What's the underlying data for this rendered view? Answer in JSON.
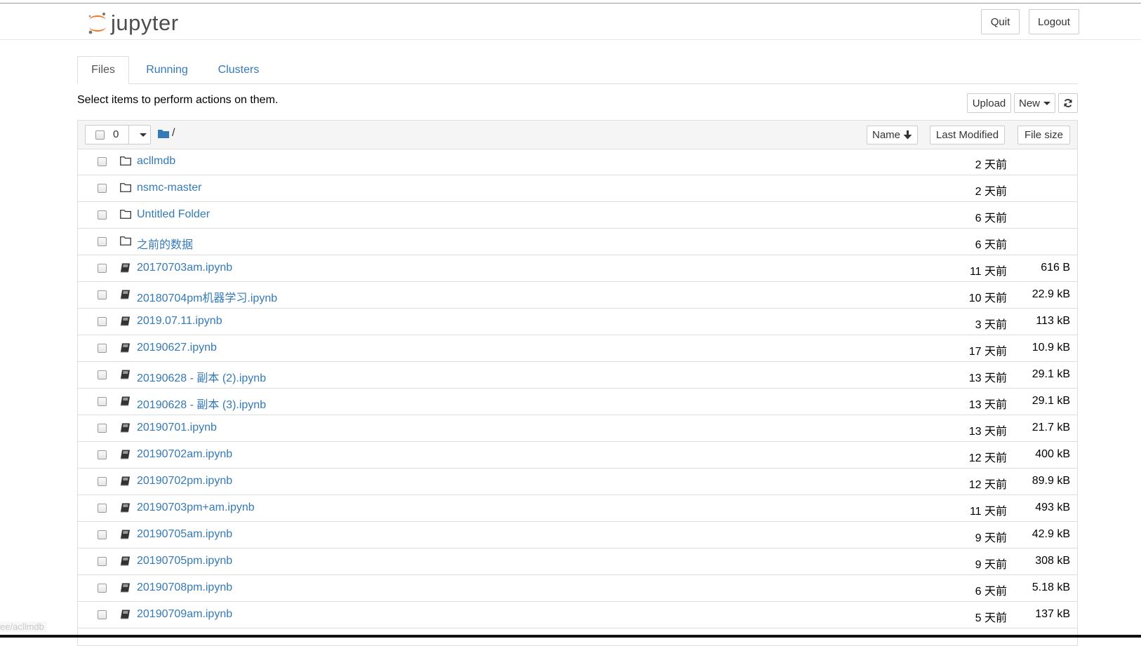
{
  "header": {
    "logo_text": "jupyter",
    "quit_label": "Quit",
    "logout_label": "Logout"
  },
  "tabs": [
    {
      "label": "Files",
      "active": true
    },
    {
      "label": "Running",
      "active": false
    },
    {
      "label": "Clusters",
      "active": false
    }
  ],
  "toolbar": {
    "instructions": "Select items to perform actions on them.",
    "upload_label": "Upload",
    "new_label": "New"
  },
  "list_header": {
    "selected_count": "0",
    "breadcrumb": "/",
    "sort_name_label": "Name",
    "sort_modified_label": "Last Modified",
    "sort_size_label": "File size"
  },
  "files": [
    {
      "type": "folder",
      "name": "acllmdb",
      "modified": "2 天前",
      "size": ""
    },
    {
      "type": "folder",
      "name": "nsmc-master",
      "modified": "2 天前",
      "size": ""
    },
    {
      "type": "folder",
      "name": "Untitled Folder",
      "modified": "6 天前",
      "size": ""
    },
    {
      "type": "folder",
      "name": "之前的数据",
      "modified": "6 天前",
      "size": ""
    },
    {
      "type": "notebook",
      "name": "20170703am.ipynb",
      "modified": "11 天前",
      "size": "616 B"
    },
    {
      "type": "notebook",
      "name": "20180704pm机器学习.ipynb",
      "modified": "10 天前",
      "size": "22.9 kB"
    },
    {
      "type": "notebook",
      "name": "2019.07.11.ipynb",
      "modified": "3 天前",
      "size": "113 kB"
    },
    {
      "type": "notebook",
      "name": "20190627.ipynb",
      "modified": "17 天前",
      "size": "10.9 kB"
    },
    {
      "type": "notebook",
      "name": "20190628 - 副本 (2).ipynb",
      "modified": "13 天前",
      "size": "29.1 kB"
    },
    {
      "type": "notebook",
      "name": "20190628 - 副本 (3).ipynb",
      "modified": "13 天前",
      "size": "29.1 kB"
    },
    {
      "type": "notebook",
      "name": "20190701.ipynb",
      "modified": "13 天前",
      "size": "21.7 kB"
    },
    {
      "type": "notebook",
      "name": "20190702am.ipynb",
      "modified": "12 天前",
      "size": "400 kB"
    },
    {
      "type": "notebook",
      "name": "20190702pm.ipynb",
      "modified": "12 天前",
      "size": "89.9 kB"
    },
    {
      "type": "notebook",
      "name": "20190703pm+am.ipynb",
      "modified": "11 天前",
      "size": "493 kB"
    },
    {
      "type": "notebook",
      "name": "20190705am.ipynb",
      "modified": "9 天前",
      "size": "42.9 kB"
    },
    {
      "type": "notebook",
      "name": "20190705pm.ipynb",
      "modified": "9 天前",
      "size": "308 kB"
    },
    {
      "type": "notebook",
      "name": "20190708pm.ipynb",
      "modified": "6 天前",
      "size": "5.18 kB"
    },
    {
      "type": "notebook",
      "name": "20190709am.ipynb",
      "modified": "5 天前",
      "size": "137 kB"
    }
  ],
  "status_bar": {
    "url": "ee/acllmdb"
  },
  "colors": {
    "link": "#337ab7",
    "logo_orange": "#f37726",
    "header_gray": "#f5f5f5",
    "border": "#dddddd"
  }
}
